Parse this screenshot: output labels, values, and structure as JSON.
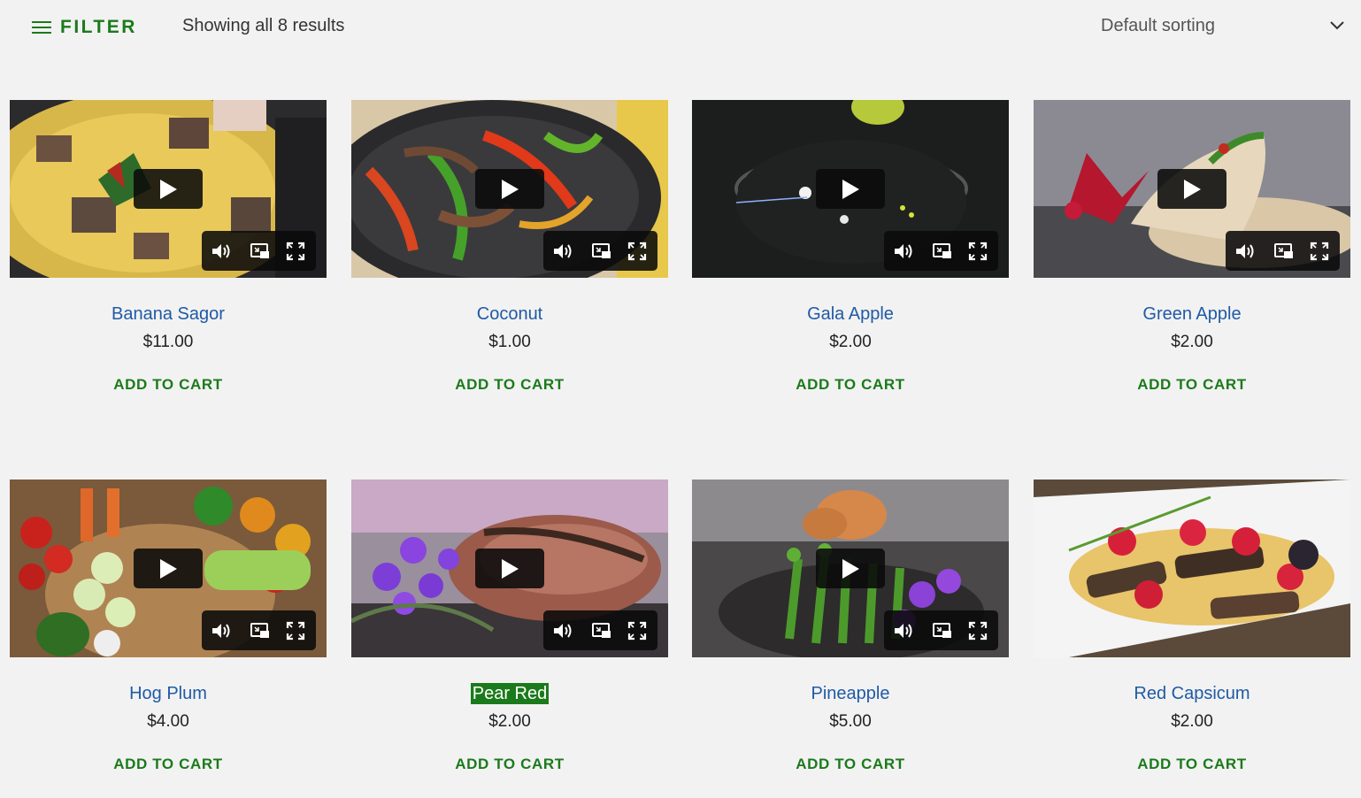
{
  "toolbar": {
    "filter_label": "FILTER",
    "results_text": "Showing all 8 results",
    "sorting_value": "Default sorting"
  },
  "products": [
    {
      "name": "Banana Sagor",
      "price": "$11.00",
      "cta": "ADD TO CART",
      "has_video_controls": true
    },
    {
      "name": "Coconut",
      "price": "$1.00",
      "cta": "ADD TO CART",
      "has_video_controls": true
    },
    {
      "name": "Gala Apple",
      "price": "$2.00",
      "cta": "ADD TO CART",
      "has_video_controls": true
    },
    {
      "name": "Green Apple",
      "price": "$2.00",
      "cta": "ADD TO CART",
      "has_video_controls": true
    },
    {
      "name": "Hog Plum",
      "price": "$4.00",
      "cta": "ADD TO CART",
      "has_video_controls": true
    },
    {
      "name": "Pear Red",
      "price": "$2.00",
      "cta": "ADD TO CART",
      "has_video_controls": true,
      "selected": true
    },
    {
      "name": "Pineapple",
      "price": "$5.00",
      "cta": "ADD TO CART",
      "has_video_controls": true
    },
    {
      "name": "Red Capsicum",
      "price": "$2.00",
      "cta": "ADD TO CART",
      "has_video_controls": false
    }
  ],
  "colors": {
    "accent_green": "#1b7a1b",
    "link_blue": "#1f5aa6",
    "background": "#f2f2f2"
  }
}
